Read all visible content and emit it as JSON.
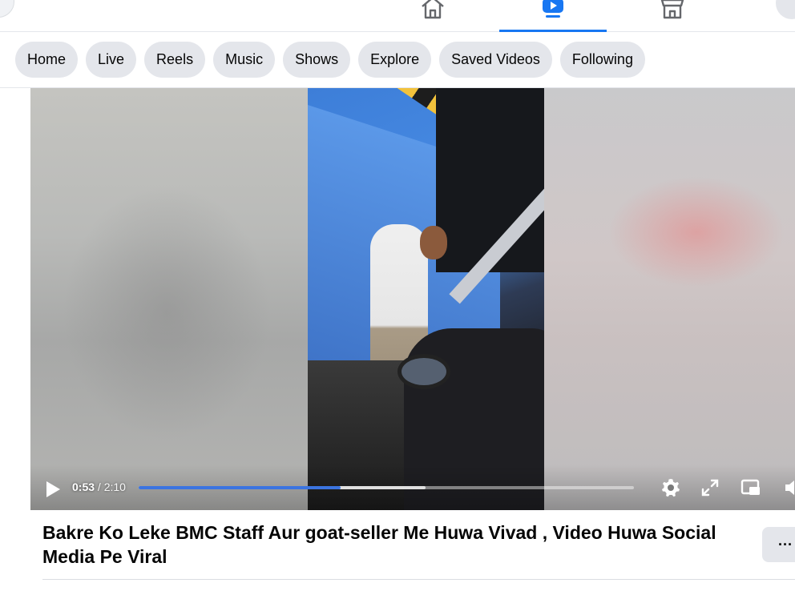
{
  "nav": {
    "tabs": [
      {
        "name": "home",
        "icon": "home-icon",
        "active": false
      },
      {
        "name": "video",
        "icon": "video-play-icon",
        "active": true
      },
      {
        "name": "marketplace",
        "icon": "marketplace-icon",
        "active": false
      }
    ]
  },
  "chips": [
    "Home",
    "Live",
    "Reels",
    "Music",
    "Shows",
    "Explore",
    "Saved Videos",
    "Following"
  ],
  "video": {
    "current_time": "0:53",
    "duration": "2:10",
    "time_separator": " / ",
    "progress_fraction": 0.408,
    "buffered_fraction": 0.58,
    "controls": [
      "play-icon",
      "settings-icon",
      "fullscreen-icon",
      "picture-in-picture-icon",
      "volume-icon"
    ]
  },
  "post": {
    "title": "Bakre Ko Leke BMC Staff Aur goat-seller Me Huwa Vivad , Video Huwa Social Media Pe Viral",
    "more_label": "···"
  },
  "colors": {
    "accent": "#1877f2",
    "progress": "#3b74e0",
    "chip_bg": "#e4e6eb"
  }
}
